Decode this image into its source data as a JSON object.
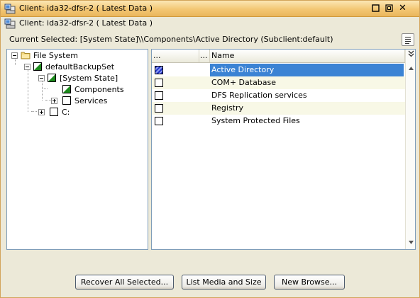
{
  "window": {
    "title": "Client: ida32-dfsr-2 ( Latest Data )",
    "subtitle": "Client: ida32-dfsr-2 ( Latest Data )",
    "close_glyph": "✕"
  },
  "current_selected": "Current Selected: [System State]\\\\Components\\Active Directory (Subclient:default)",
  "tree": {
    "nodes": [
      {
        "label": "File System",
        "icon": "folder-icon",
        "expanded": true,
        "level": 0
      },
      {
        "label": "defaultBackupSet",
        "check": "partial",
        "expanded": true,
        "level": 1
      },
      {
        "label": "[System State]",
        "check": "partial",
        "expanded": true,
        "level": 2
      },
      {
        "label": "Components",
        "check": "partial",
        "level": 3
      },
      {
        "label": "Services",
        "check": "unchecked",
        "expanded": false,
        "level": 3
      },
      {
        "label": "C:",
        "check": "unchecked",
        "expanded": false,
        "level": 2
      }
    ]
  },
  "list": {
    "columns": [
      "...",
      "...",
      "Name"
    ],
    "rows": [
      {
        "name": "Active Directory",
        "selected": true,
        "check": "blue"
      },
      {
        "name": "COM+ Database",
        "selected": false,
        "check": "unchecked"
      },
      {
        "name": "DFS Replication services",
        "selected": false,
        "check": "unchecked"
      },
      {
        "name": "Registry",
        "selected": false,
        "check": "unchecked"
      },
      {
        "name": "System Protected Files",
        "selected": false,
        "check": "unchecked"
      }
    ]
  },
  "buttons": {
    "recover": "Recover All Selected...",
    "list_media": "List Media and Size",
    "new_browse": "New Browse..."
  },
  "colors": {
    "titlebar": "#f3c774",
    "selection": "#3b83d4",
    "partial_check": "#1c8a1c",
    "alt_row": "#f8f8e6"
  }
}
